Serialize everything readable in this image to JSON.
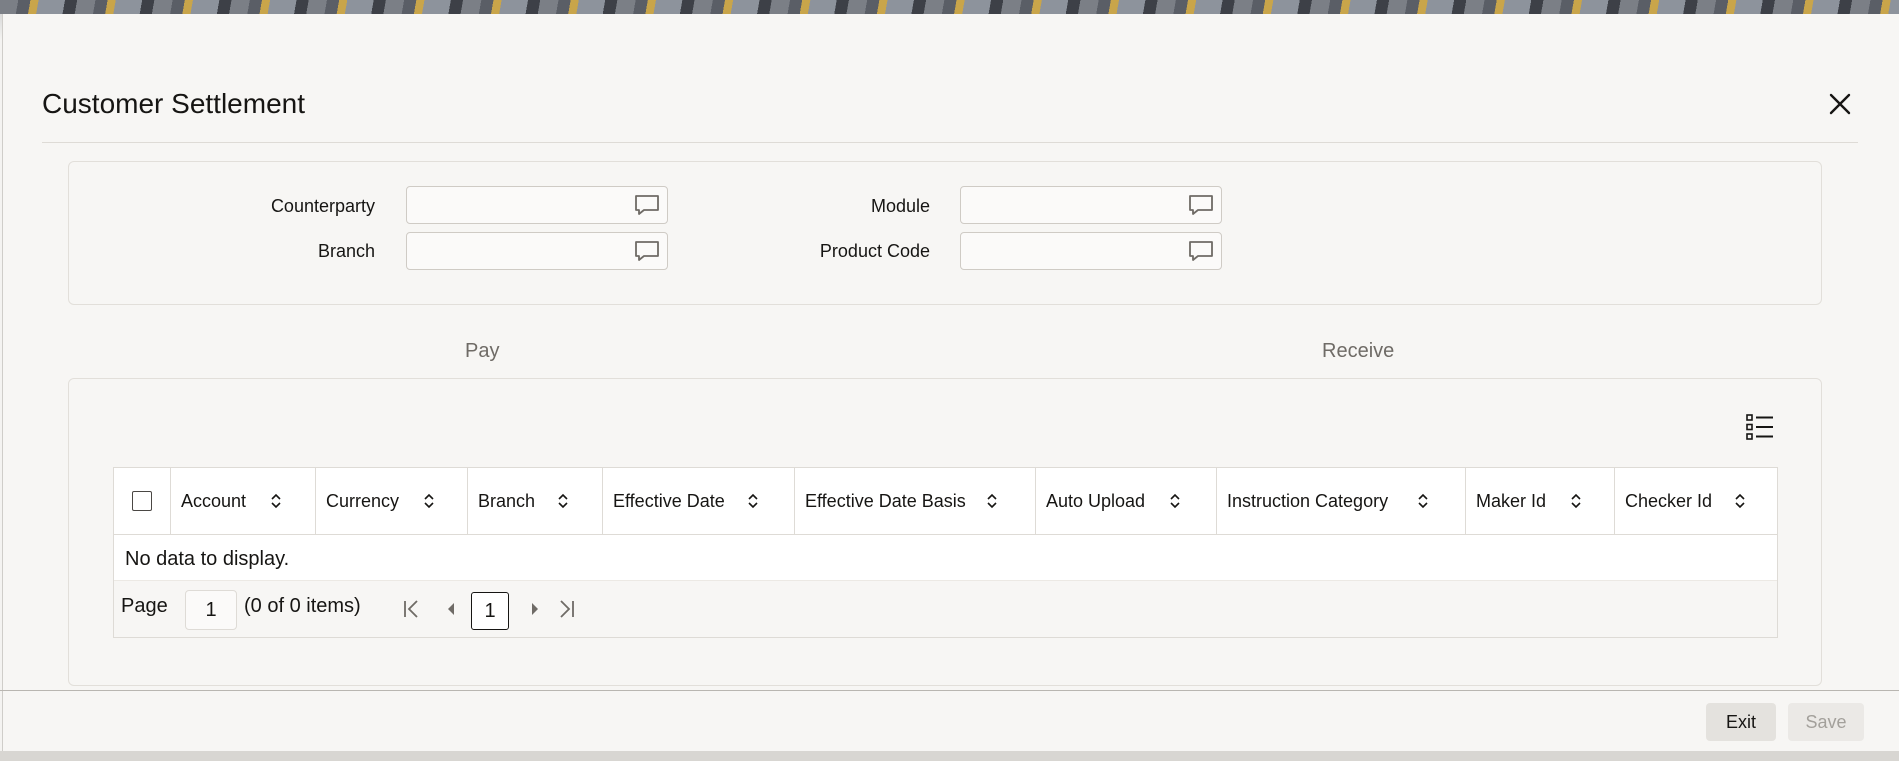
{
  "dialog": {
    "title": "Customer Settlement"
  },
  "criteria": {
    "counterparty": {
      "label": "Counterparty",
      "value": ""
    },
    "branch": {
      "label": "Branch",
      "value": ""
    },
    "module": {
      "label": "Module",
      "value": ""
    },
    "product_code": {
      "label": "Product Code",
      "value": ""
    }
  },
  "tabs": [
    {
      "label": "Pay"
    },
    {
      "label": "Receive"
    }
  ],
  "table": {
    "columns": [
      "Account",
      "Currency",
      "Branch",
      "Effective Date",
      "Effective Date Basis",
      "Auto Upload",
      "Instruction Category",
      "Maker Id",
      "Checker Id"
    ],
    "empty_message": "No data to display."
  },
  "pager": {
    "page_label": "Page",
    "page_value": "1",
    "items_text": "(0 of 0 items)",
    "current_page": "1"
  },
  "footer": {
    "exit_label": "Exit",
    "save_label": "Save"
  },
  "icons": {
    "close": "close-icon",
    "lov": "speech-bubble-icon",
    "columns": "column-manager-icon",
    "sort": "sort-arrows-icon",
    "first": "first-page-icon",
    "prev": "previous-page-icon",
    "next": "next-page-icon",
    "last": "last-page-icon"
  }
}
